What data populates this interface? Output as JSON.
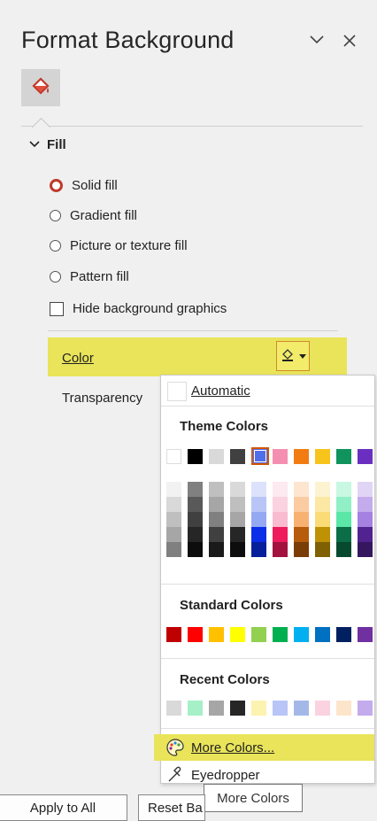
{
  "pane": {
    "title": "Format Background",
    "tab_icon": "fill-bucket-icon"
  },
  "fill": {
    "section_label": "Fill",
    "options": [
      {
        "label": "Solid fill",
        "selected": true
      },
      {
        "label": "Gradient fill",
        "selected": false
      },
      {
        "label": "Picture or texture fill",
        "selected": false
      },
      {
        "label": "Pattern fill",
        "selected": false
      }
    ],
    "hide_bg_label": "Hide background graphics",
    "color_label": "Color",
    "transparency_label": "Transparency"
  },
  "color_menu": {
    "automatic_label": "Automatic",
    "theme_heading": "Theme Colors",
    "standard_heading": "Standard Colors",
    "recent_heading": "Recent Colors",
    "more_colors_label": "More Colors...",
    "eyedropper_label": "Eyedropper",
    "theme_top": [
      "#ffffff",
      "#000000",
      "#d9d9d9",
      "#404040",
      "#4f6ee9",
      "#f48fb1",
      "#f27c12",
      "#f7c41c",
      "#10935d",
      "#6a2fc0"
    ],
    "theme_selected_index": 4,
    "theme_shades": [
      [
        "#f2f2f2",
        "#d9d9d9",
        "#bfbfbf",
        "#a6a6a6",
        "#808080"
      ],
      [
        "#808080",
        "#595959",
        "#404040",
        "#262626",
        "#0d0d0d"
      ],
      [
        "#bfbfbf",
        "#a6a6a6",
        "#808080",
        "#404040",
        "#1a1a1a"
      ],
      [
        "#d9d9d9",
        "#bfbfbf",
        "#a6a6a6",
        "#262626",
        "#0d0d0d"
      ],
      [
        "#dce2fb",
        "#b9c5f6",
        "#95a8f2",
        "#0a2ee8",
        "#071f9b"
      ],
      [
        "#fde9f0",
        "#fbd2e0",
        "#f9bbd0",
        "#ee1c5c",
        "#a3123f"
      ],
      [
        "#fde5d0",
        "#fbcba1",
        "#f9b172",
        "#b75c0c",
        "#7a3d08"
      ],
      [
        "#fdf3d1",
        "#fce7a4",
        "#fadb76",
        "#bf9206",
        "#7f6104"
      ],
      [
        "#c8f7e2",
        "#91efc5",
        "#5ae7a8",
        "#0b6e46",
        "#07492e"
      ],
      [
        "#e1d5f5",
        "#c3abec",
        "#a581e2",
        "#502390",
        "#351760"
      ]
    ],
    "standard": [
      "#c00000",
      "#ff0000",
      "#ffc000",
      "#ffff00",
      "#92d050",
      "#00b050",
      "#00b0f0",
      "#0070c0",
      "#002060",
      "#7030a0"
    ],
    "recent": [
      "#d9d9d9",
      "#a6f0c8",
      "#a6a6a6",
      "#262626",
      "#fdf3b0",
      "#b9c5f6",
      "#a4b8e8",
      "#fbd2e0",
      "#fde5cc",
      "#c3abec"
    ]
  },
  "tooltip": "More Colors",
  "footer": {
    "apply_all": "Apply to All",
    "reset": "Reset Ba"
  }
}
